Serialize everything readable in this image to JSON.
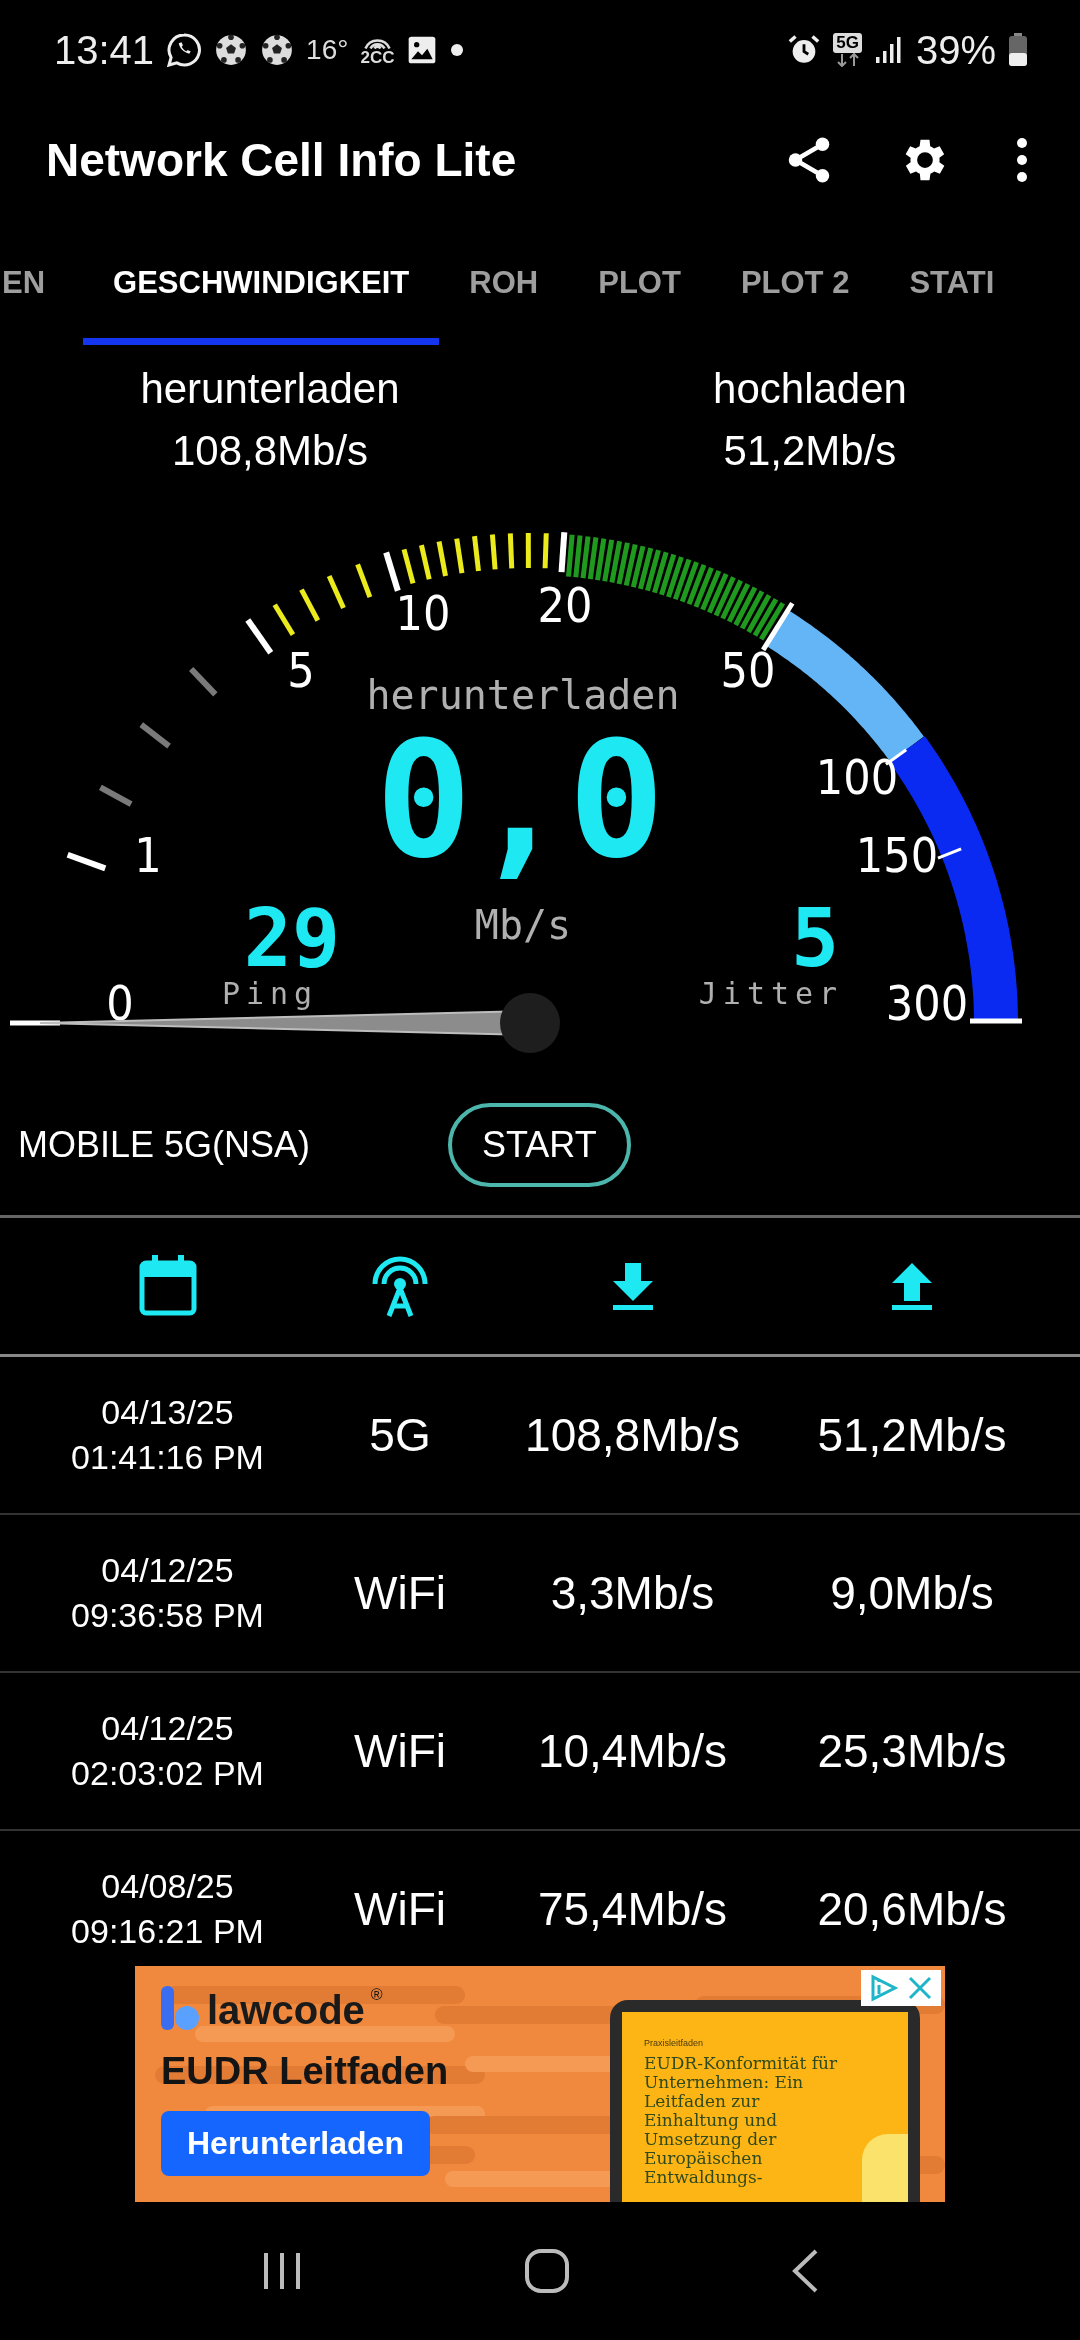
{
  "status_bar": {
    "time": "13:41",
    "temperature": "16°",
    "nfc_label": "2CC",
    "network": "5G",
    "battery": "39%"
  },
  "app_bar": {
    "title": "Network Cell Info Lite"
  },
  "tabs": [
    {
      "label": "EN",
      "selected": false
    },
    {
      "label": "GESCHWINDIGKEIT",
      "selected": true
    },
    {
      "label": "ROH",
      "selected": false
    },
    {
      "label": "PLOT",
      "selected": false
    },
    {
      "label": "PLOT 2",
      "selected": false
    },
    {
      "label": "STATI",
      "selected": false
    }
  ],
  "summary": [
    {
      "label": "herunterladen",
      "value": "108,8Mb/s"
    },
    {
      "label": "hochladen",
      "value": "51,2Mb/s"
    }
  ],
  "gauge": {
    "scale_labels": [
      "0",
      "1",
      "5",
      "10",
      "20",
      "50",
      "100",
      "150",
      "300"
    ],
    "mode": "herunterladen",
    "speed": "0,0",
    "unit": "Mb/s",
    "ping": "29",
    "ping_label": "Ping",
    "jitter": "5",
    "jitter_label": "Jitter"
  },
  "connection": "MOBILE 5G(NSA)",
  "start_button": "START",
  "history": [
    {
      "date": "04/13/25",
      "time": "01:41:16 PM",
      "network": "5G",
      "download": "108,8Mb/s",
      "upload": "51,2Mb/s"
    },
    {
      "date": "04/12/25",
      "time": "09:36:58 PM",
      "network": "WiFi",
      "download": "3,3Mb/s",
      "upload": "9,0Mb/s"
    },
    {
      "date": "04/12/25",
      "time": "02:03:02 PM",
      "network": "WiFi",
      "download": "10,4Mb/s",
      "upload": "25,3Mb/s"
    },
    {
      "date": "04/08/25",
      "time": "09:16:21 PM",
      "network": "WiFi",
      "download": "75,4Mb/s",
      "upload": "20,6Mb/s"
    }
  ],
  "ad": {
    "brand": "lawcode",
    "registered": "®",
    "headline": "EUDR Leitfaden",
    "button": "Herunterladen",
    "doc_kicker": "Praxisleitfaden",
    "doc_title": "EUDR-Konformität für Unternehmen: Ein Leitfaden zur Einhaltung und Umsetzung der Europäischen Entwaldungs-"
  }
}
